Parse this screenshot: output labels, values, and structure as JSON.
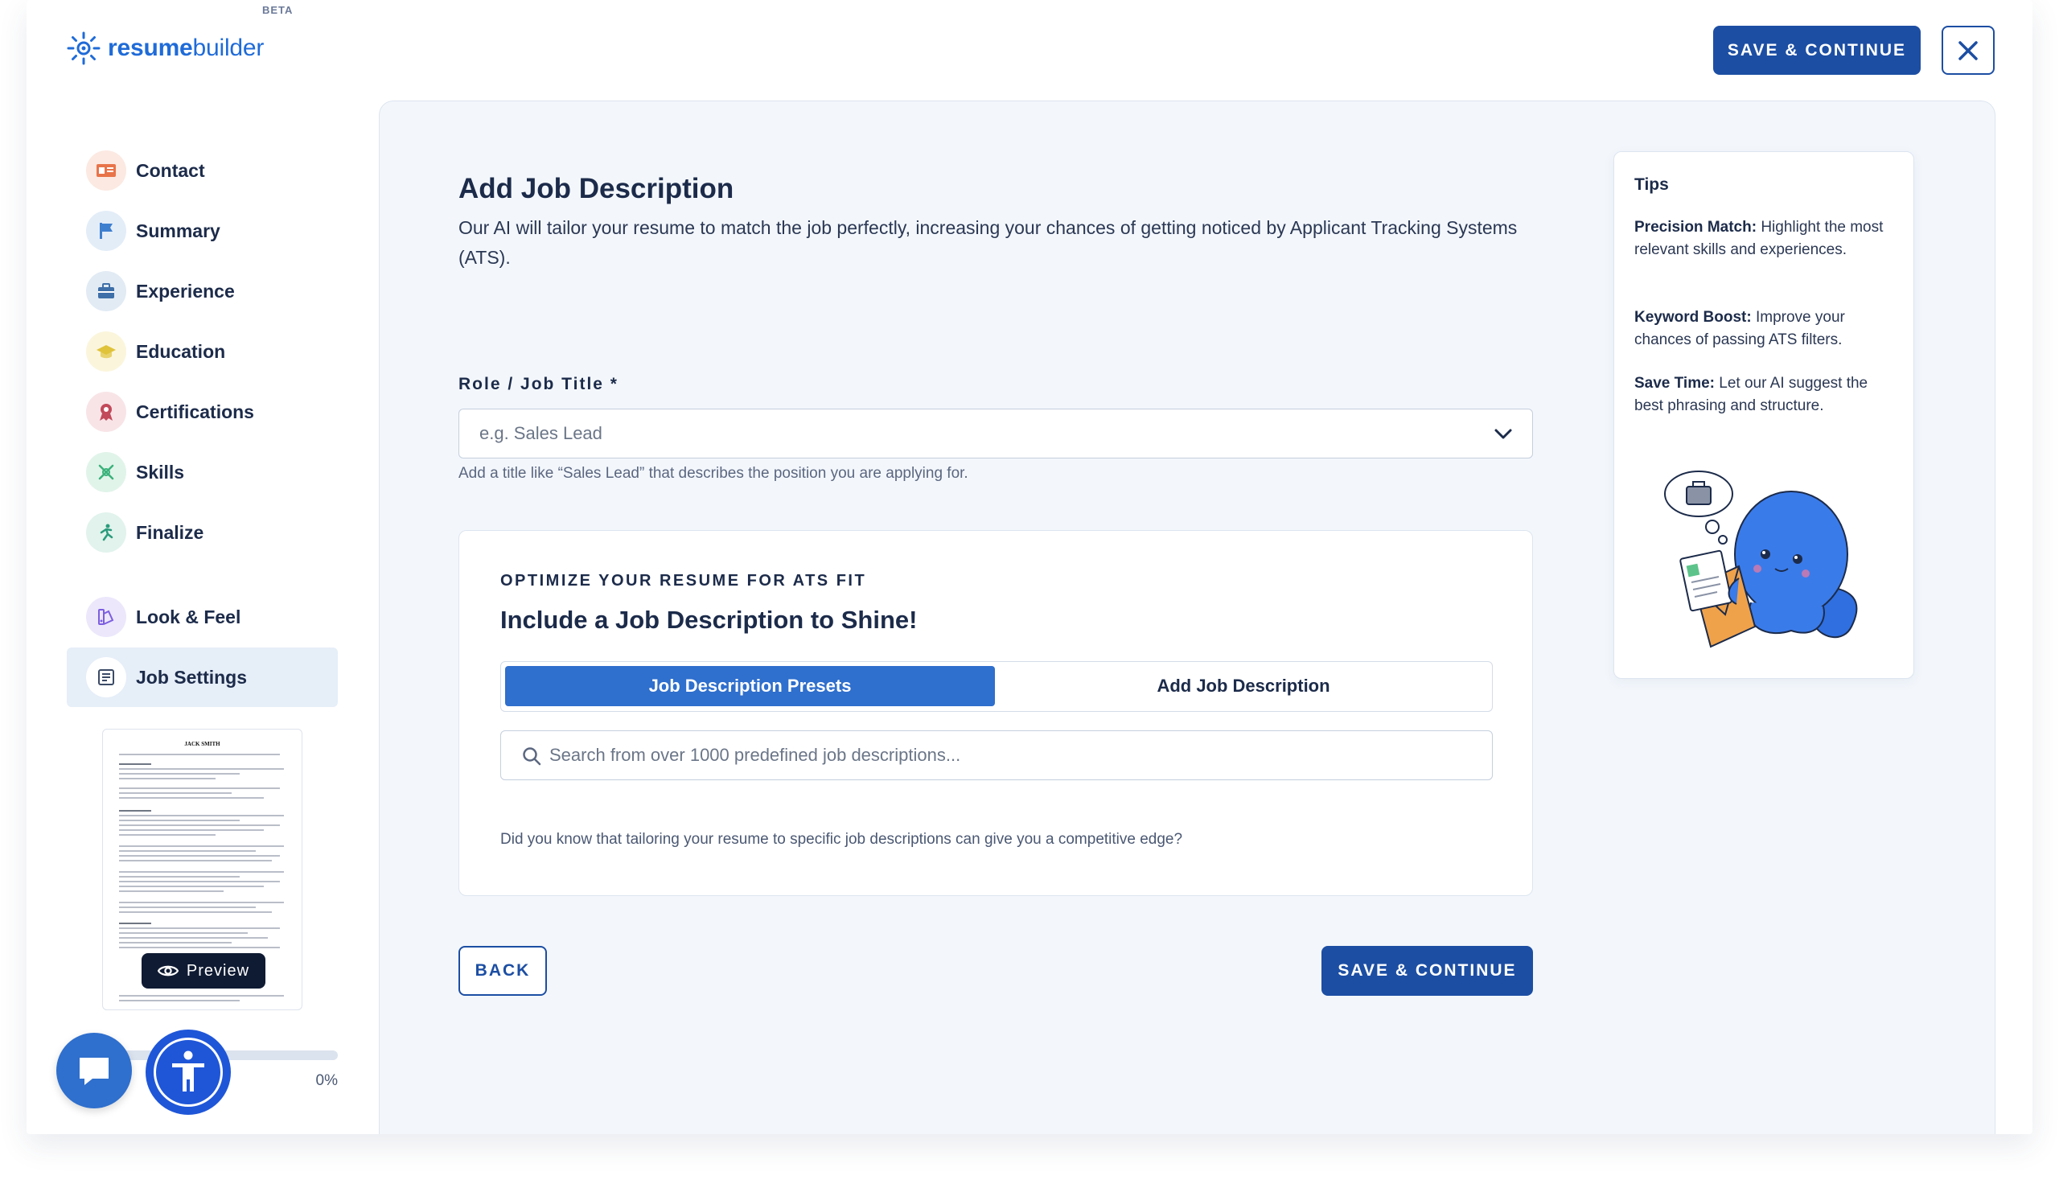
{
  "header": {
    "logo_text_bold": "resume",
    "logo_text_rest": "builder",
    "logo_badge": "BETA",
    "save_label": "SAVE & CONTINUE",
    "close_icon": "close-icon"
  },
  "sidebar": {
    "items": [
      {
        "label": "Contact",
        "icon": "contact-card-icon",
        "color": "#e8744a",
        "bg": "#fbe9e2"
      },
      {
        "label": "Summary",
        "icon": "flag-icon",
        "color": "#3f7fcf",
        "bg": "#e3edf8"
      },
      {
        "label": "Experience",
        "icon": "briefcase-icon",
        "color": "#3e6fa8",
        "bg": "#e2ebf4"
      },
      {
        "label": "Education",
        "icon": "graduation-cap-icon",
        "color": "#e0c33a",
        "bg": "#fbf5dc"
      },
      {
        "label": "Certifications",
        "icon": "award-ribbon-icon",
        "color": "#c24a5a",
        "bg": "#f8e4e7"
      },
      {
        "label": "Skills",
        "icon": "skills-icon",
        "color": "#3bb27b",
        "bg": "#e1f4ea"
      },
      {
        "label": "Finalize",
        "icon": "finish-runner-icon",
        "color": "#2b9b7d",
        "bg": "#e1f3ec"
      },
      {
        "label": "Look & Feel",
        "icon": "palette-icon",
        "color": "#7c5ee0",
        "bg": "#ece7fb"
      },
      {
        "label": "Job Settings",
        "icon": "job-settings-icon",
        "color": "#3b4a66",
        "bg": "#ffffff"
      }
    ],
    "active_index": 8,
    "resume_preview": {
      "name": "JACK SMITH",
      "preview_label": "Preview"
    },
    "progress": {
      "percent": 0,
      "label": "0%"
    }
  },
  "main": {
    "title": "Add Job Description",
    "subtitle": "Our AI will tailor your resume to match the job perfectly, increasing your chances of getting noticed by Applicant Tracking Systems (ATS).",
    "role_field": {
      "label": "Role / Job Title *",
      "placeholder": "e.g. Sales Lead",
      "help": "Add a title like “Sales Lead” that describes the position you are applying for."
    },
    "ats_card": {
      "eyebrow": "OPTIMIZE YOUR RESUME FOR ATS FIT",
      "title": "Include a Job Description to Shine!",
      "tabs": [
        {
          "label": "Job Description Presets",
          "active": true
        },
        {
          "label": "Add Job Description",
          "active": false
        }
      ],
      "search_placeholder": "Search from over 1000 predefined job descriptions...",
      "note": "Did you know that tailoring your resume to specific job descriptions can give you a competitive edge?"
    },
    "back_label": "BACK",
    "save_label": "SAVE & CONTINUE"
  },
  "tips": {
    "title": "Tips",
    "items": [
      {
        "bold": "Precision Match:",
        "text": " Highlight the most relevant skills and experiences."
      },
      {
        "bold": "Keyword Boost:",
        "text": " Improve your chances of passing ATS filters."
      },
      {
        "bold": "Save Time:",
        "text": " Let our AI suggest the best phrasing and structure."
      }
    ]
  },
  "colors": {
    "brand": "#1f6bd8",
    "primary_button": "#1c4ea3",
    "active_tab": "#2f6fcd",
    "panel_bg": "#f3f7fc"
  }
}
